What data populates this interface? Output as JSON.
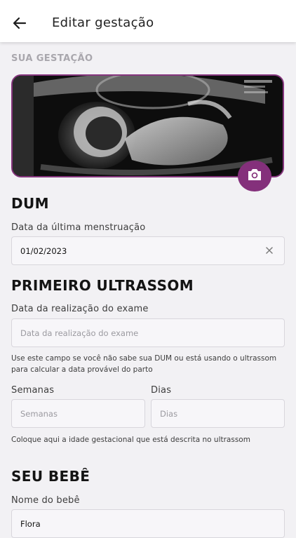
{
  "header": {
    "title": "Editar gestação",
    "back_icon": "arrow-left-icon"
  },
  "pregnancy": {
    "caption": "SUA GESTAÇÃO",
    "camera_icon": "camera-icon",
    "accent_color": "#84307b"
  },
  "dum": {
    "heading": "DUM",
    "label": "Data da última menstruação",
    "value": "01/02/2023",
    "clear_icon": "close-icon"
  },
  "ultrasound": {
    "heading": "PRIMEIRO ULTRASSOM",
    "exam_label": "Data da realização do exame",
    "exam_placeholder": "Data da realização do exame",
    "exam_hint": "Use este campo se você não sabe sua DUM ou está usando o ultrassom para calcular a data provável do parto",
    "weeks_label": "Semanas",
    "weeks_placeholder": "Semanas",
    "days_label": "Dias",
    "days_placeholder": "Dias",
    "age_hint": "Coloque aqui a idade gestacional que está descrita no ultrassom"
  },
  "baby": {
    "heading": "SEU BEBÊ",
    "name_label": "Nome do bebê",
    "name_value": "Flora"
  }
}
